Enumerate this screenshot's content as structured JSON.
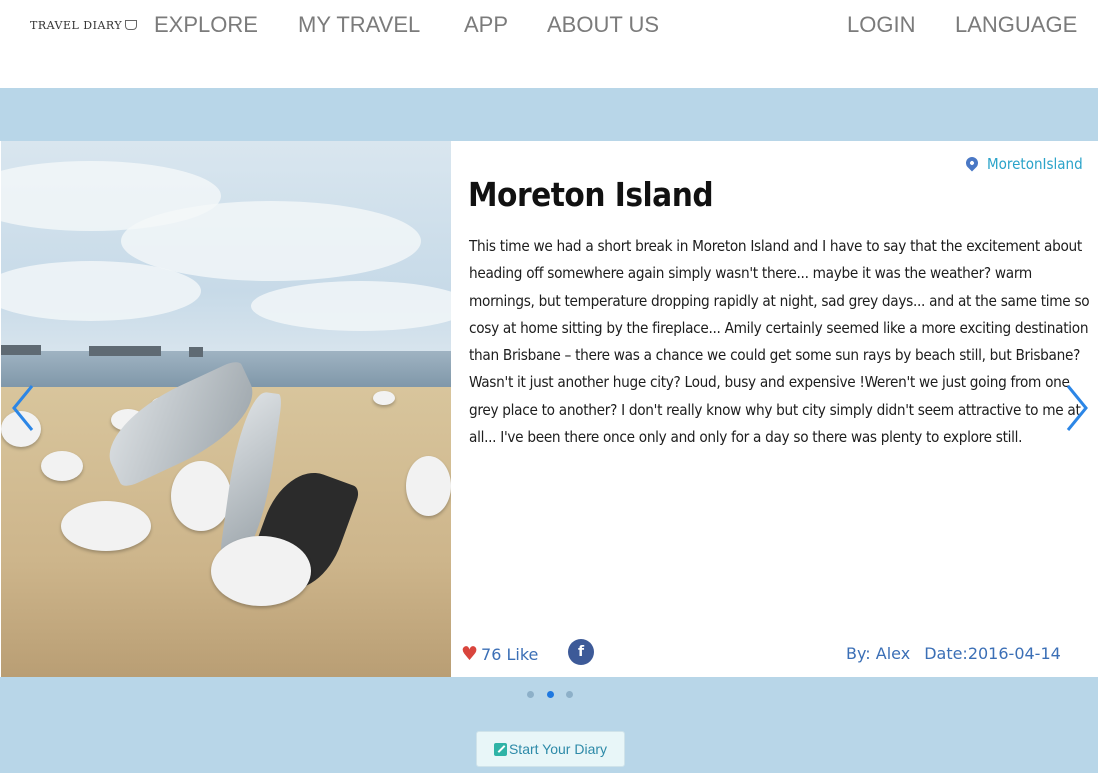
{
  "nav": {
    "logo": "Travel Diary",
    "explore": "EXPLORE",
    "my_travel": "MY TRAVEL",
    "app": "APP",
    "about_us": "ABOUT US",
    "login": "LOGIN",
    "language": "LANGUAGE"
  },
  "slide": {
    "location": "MoretonIsland",
    "title": "Moreton Island",
    "story": "This time we had a short break in Moreton Island and I have to say that the excitement about heading off somewhere again simply wasn't there... maybe it was the weather? warm mornings, but temperature dropping rapidly at night, sad grey days... and at the same time so cosy at home sitting by the fireplace... Amily certainly seemed like a more exciting destination than Brisbane – there was a chance we could get some sun rays by beach still, but Brisbane? Wasn't it just another huge city? Loud, busy and expensive !Weren't we just going from one grey place to another? I don't really know why but city simply didn't seem attractive to me at all... I've been there once only and only for a day so there was plenty to explore still.",
    "likes": "76 Like",
    "facebook": "f",
    "author": "By: Alex",
    "date": "Date:2016-04-14"
  },
  "carousel": {
    "dots": 3,
    "active_dot": 2
  },
  "diary_button": "Start Your Diary",
  "colors": {
    "band": "#b8d6e8",
    "nav_text": "#7b7b7b",
    "meta_text": "#3b6fb6",
    "location_text": "#2aa3c9",
    "heart": "#d9453d",
    "active_dot": "#1e78e0"
  },
  "icons": {
    "logo": "cup-icon",
    "location": "map-pin-icon",
    "like": "heart-icon",
    "share": "facebook-icon",
    "prev": "chevron-left-icon",
    "next": "chevron-right-icon",
    "diary": "edit-icon"
  }
}
